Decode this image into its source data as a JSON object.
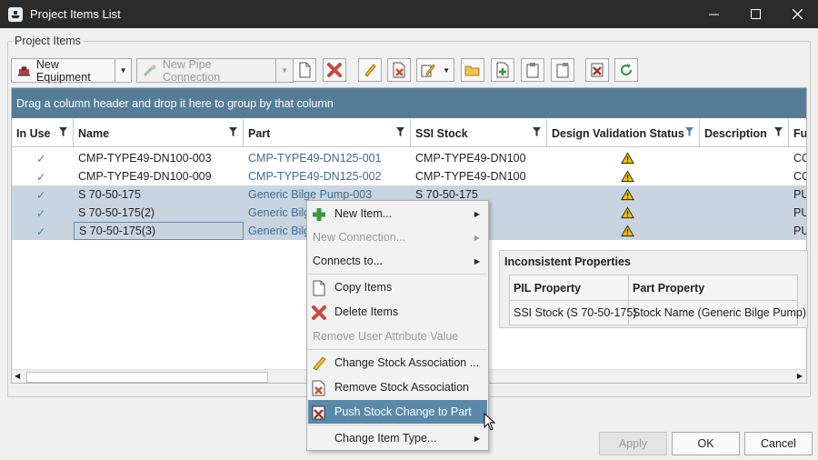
{
  "window": {
    "title": "Project Items List"
  },
  "group": {
    "legend": "Project Items"
  },
  "toolbar": {
    "new_equipment": "New Equipment",
    "new_pipe_connection": "New Pipe Connection",
    "icons": [
      "copy-icon",
      "delete-icon",
      "pencil-icon",
      "remove-stock-icon",
      "edit-dropdown-icon",
      "open-folder-icon",
      "import-icon",
      "paste-icon",
      "paste-special-icon",
      "push-stock-icon",
      "refresh-icon"
    ]
  },
  "grid": {
    "group_banner": "Drag a column header and drop it here to group by that column",
    "columns": [
      "In Use",
      "Name",
      "Part",
      "SSI Stock",
      "Design Validation Status",
      "Description",
      "Fu"
    ],
    "rows": [
      {
        "in_use": "✓",
        "name": "CMP-TYPE49-DN100-003",
        "part": "CMP-TYPE49-DN125-001",
        "ssi_stock": "CMP-TYPE49-DN100",
        "status": "warning",
        "fu": "CO"
      },
      {
        "in_use": "✓",
        "name": "CMP-TYPE49-DN100-009",
        "part": "CMP-TYPE49-DN125-002",
        "ssi_stock": "CMP-TYPE49-DN100",
        "status": "warning",
        "fu": "CO"
      },
      {
        "in_use": "✓",
        "name": "S 70-50-175",
        "part": "Generic Bilge Pump-003",
        "ssi_stock": "S 70-50-175",
        "status": "warning",
        "fu": "PU"
      },
      {
        "in_use": "✓",
        "name": "S 70-50-175(2)",
        "part": "Generic Bilge",
        "ssi_stock": "",
        "status": "warning",
        "fu": "PU"
      },
      {
        "in_use": "✓",
        "name": "S 70-50-175(3)",
        "part": "Generic Bilge",
        "ssi_stock": "",
        "status": "warning",
        "fu": "PU"
      }
    ]
  },
  "inconsistent": {
    "title": "Inconsistent Properties",
    "headers": [
      "PIL Property",
      "Part Property"
    ],
    "rows": [
      [
        "SSI Stock (S 70-50-175)",
        "Stock Name (Generic Bilge Pump)"
      ]
    ]
  },
  "context_menu": {
    "items": [
      {
        "label": "New Item...",
        "icon": "plus-icon",
        "submenu": true,
        "enabled": true
      },
      {
        "label": "New Connection...",
        "icon": "",
        "submenu": true,
        "enabled": false
      },
      {
        "label": "Connects to...",
        "icon": "",
        "submenu": true,
        "enabled": true
      },
      {
        "label": "Copy Items",
        "icon": "copy-icon",
        "submenu": false,
        "enabled": true
      },
      {
        "label": "Delete Items",
        "icon": "delete-icon",
        "submenu": false,
        "enabled": true
      },
      {
        "label": "Remove User Attribute Value",
        "icon": "",
        "submenu": false,
        "enabled": false
      },
      {
        "label": "Change Stock Association ...",
        "icon": "pencil-icon",
        "submenu": false,
        "enabled": true
      },
      {
        "label": "Remove Stock Association",
        "icon": "remove-stock-icon",
        "submenu": false,
        "enabled": true
      },
      {
        "label": "Push Stock Change to Part",
        "icon": "push-stock-icon",
        "submenu": false,
        "enabled": true,
        "highlighted": true
      },
      {
        "label": "Change Item Type...",
        "icon": "",
        "submenu": true,
        "enabled": true
      }
    ]
  },
  "footer": {
    "apply": "Apply",
    "ok": "OK",
    "cancel": "Cancel"
  },
  "colors": {
    "accent": "#557d98",
    "highlight": "#5b89a8",
    "selection": "#c8d5e1",
    "link": "#3d6d8f"
  }
}
